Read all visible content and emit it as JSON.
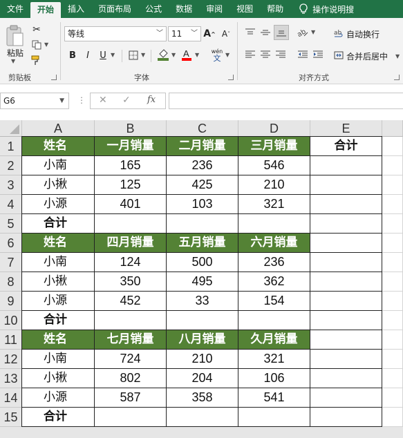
{
  "ribbon_tabs": [
    "文件",
    "开始",
    "插入",
    "页面布局",
    "公式",
    "数据",
    "审阅",
    "视图",
    "帮助"
  ],
  "active_tab": "开始",
  "tell_me": "操作说明搜",
  "clipboard": {
    "paste_label": "粘贴",
    "group_label": "剪贴板"
  },
  "font": {
    "name": "等线",
    "size": "11",
    "bold": "B",
    "italic": "I",
    "underline": "U",
    "wen": "wén",
    "group_label": "字体"
  },
  "alignment": {
    "wrap_text": "自动换行",
    "merge_center": "合并后居中",
    "group_label": "对齐方式"
  },
  "name_box": "G6",
  "formula": "",
  "columns": [
    "A",
    "B",
    "C",
    "D",
    "E"
  ],
  "rows": [
    "1",
    "2",
    "3",
    "4",
    "5",
    "6",
    "7",
    "8",
    "9",
    "10",
    "11",
    "12",
    "13",
    "14",
    "15"
  ],
  "sheet": [
    [
      "姓名",
      "一月销量",
      "二月销量",
      "三月销量",
      "合计"
    ],
    [
      "小南",
      "165",
      "236",
      "546",
      ""
    ],
    [
      "小揪",
      "125",
      "425",
      "210",
      ""
    ],
    [
      "小源",
      "401",
      "103",
      "321",
      ""
    ],
    [
      "合计",
      "",
      "",
      "",
      ""
    ],
    [
      "姓名",
      "四月销量",
      "五月销量",
      "六月销量",
      ""
    ],
    [
      "小南",
      "124",
      "500",
      "236",
      ""
    ],
    [
      "小揪",
      "350",
      "495",
      "362",
      ""
    ],
    [
      "小源",
      "452",
      "33",
      "154",
      ""
    ],
    [
      "合计",
      "",
      "",
      "",
      ""
    ],
    [
      "姓名",
      "七月销量",
      "八月销量",
      "久月销量",
      ""
    ],
    [
      "小南",
      "724",
      "210",
      "321",
      ""
    ],
    [
      "小揪",
      "802",
      "204",
      "106",
      ""
    ],
    [
      "小源",
      "587",
      "358",
      "541",
      ""
    ],
    [
      "合计",
      "",
      "",
      "",
      ""
    ]
  ],
  "colors": {
    "ribbon_green": "#217346",
    "header_fill": "#548235"
  }
}
